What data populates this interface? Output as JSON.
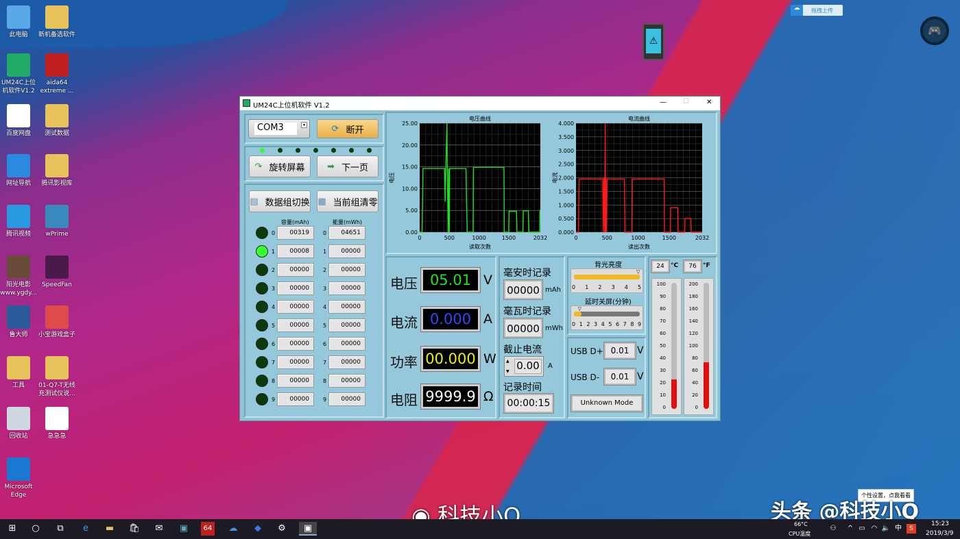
{
  "desktop": {
    "icons": [
      {
        "label": "此电脑",
        "color": "#5aa9e6"
      },
      {
        "label": "新机备选软件",
        "color": "#e8c25a"
      },
      {
        "label": "UM24C上位机软件V1.2",
        "color": "#2a6"
      },
      {
        "label": "aida64 extreme ...",
        "color": "#c02020"
      },
      {
        "label": "百度网盘",
        "color": "#fff"
      },
      {
        "label": "测试数据",
        "color": "#e8c25a"
      },
      {
        "label": "网址导航",
        "color": "#2a8ae0"
      },
      {
        "label": "腾讯影视库",
        "color": "#e8c25a"
      },
      {
        "label": "腾讯视频",
        "color": "#2a9ae0"
      },
      {
        "label": "wPrime",
        "color": "#3a8ac0"
      },
      {
        "label": "阳光电影 www.ygdy...",
        "color": "#6a4a3a"
      },
      {
        "label": "SpeedFan",
        "color": "#4a1a4a"
      },
      {
        "label": "鲁大师",
        "color": "#2a5a9a"
      },
      {
        "label": "小宝游戏盒子",
        "color": "#e04a4a"
      },
      {
        "label": "工具",
        "color": "#e8c25a"
      },
      {
        "label": "01-Q7-T无线充测试仪说...",
        "color": "#e8c25a"
      },
      {
        "label": "回收站",
        "color": "#cfd8e0"
      },
      {
        "label": "急急急",
        "color": "#fff"
      },
      {
        "label": "Microsoft Edge",
        "color": "#1a78d0"
      }
    ],
    "upload_label": "拖拽上传",
    "tooltip": "个性设置，点我看看",
    "watermark_left": "科技小Q",
    "watermark_right": "头条 @科技小Q"
  },
  "window": {
    "title": "UM24C上位机软件 V1.2",
    "minimize": "—",
    "maximize": "☐",
    "close": "✕"
  },
  "left": {
    "port": "COM3",
    "disconnect": "断开",
    "rotate": "旋转屏幕",
    "next_page": "下一页",
    "switch_group": "数据组切换",
    "clear_group": "当前组清零",
    "cap_header": "容量(mAh)",
    "energy_header": "能量(mWh)",
    "active_group": 1,
    "groups": [
      {
        "i": "0",
        "cap": "00319",
        "en": "04651"
      },
      {
        "i": "1",
        "cap": "00008",
        "en": "00000"
      },
      {
        "i": "2",
        "cap": "00000",
        "en": "00000"
      },
      {
        "i": "3",
        "cap": "00000",
        "en": "00000"
      },
      {
        "i": "4",
        "cap": "00000",
        "en": "00000"
      },
      {
        "i": "5",
        "cap": "00000",
        "en": "00000"
      },
      {
        "i": "6",
        "cap": "00000",
        "en": "00000"
      },
      {
        "i": "7",
        "cap": "00000",
        "en": "00000"
      },
      {
        "i": "8",
        "cap": "00000",
        "en": "00000"
      },
      {
        "i": "9",
        "cap": "00000",
        "en": "00000"
      }
    ]
  },
  "measure": {
    "voltage_label": "电压",
    "voltage": "05.01",
    "voltage_unit": "V",
    "current_label": "电流",
    "current": "0.000",
    "current_unit": "A",
    "power_label": "功率",
    "power": "00.000",
    "power_unit": "W",
    "resistance_label": "电阻",
    "resistance": "9999.9",
    "resistance_unit": "Ω"
  },
  "records": {
    "mah_label": "毫安时记录",
    "mah": "00000",
    "mah_unit": "mAh",
    "mwh_label": "毫瓦时记录",
    "mwh": "00000",
    "mwh_unit": "mWh",
    "cutoff_label": "截止电流",
    "cutoff": "0.00",
    "cutoff_unit": "A",
    "time_label": "记录时间",
    "time": "00:00:15"
  },
  "settings": {
    "backlight_label": "背光亮度",
    "backlight": 5,
    "backlight_ticks": [
      "0",
      "1",
      "2",
      "3",
      "4",
      "5"
    ],
    "timeout_label": "延时关屏(分钟)",
    "timeout": 1,
    "timeout_ticks": [
      "0",
      "1",
      "2",
      "3",
      "4",
      "5",
      "6",
      "7",
      "8",
      "9"
    ]
  },
  "usb": {
    "dp_label": "USB D+",
    "dp": "0.01",
    "dm_label": "USB D-",
    "dm": "0.01",
    "unit": "V",
    "mode": "Unknown Mode"
  },
  "temp": {
    "c": "24",
    "c_unit": "°C",
    "f": "76",
    "f_unit": "°F",
    "c_ticks": [
      "100",
      "90",
      "80",
      "70",
      "60",
      "50",
      "40",
      "30",
      "20",
      "10",
      "0"
    ],
    "f_ticks": [
      "200",
      "180",
      "160",
      "140",
      "120",
      "100",
      "80",
      "60",
      "40",
      "20",
      "0"
    ],
    "c_max": 100,
    "f_max": 200
  },
  "taskbar": {
    "cpu_temp": "66°C",
    "cpu_label": "CPU温度",
    "ime": "中",
    "time": "15:23",
    "date": "2019/3/9"
  },
  "chart_data": [
    {
      "type": "line",
      "title": "电压曲线",
      "xlabel": "读取次数",
      "ylabel": "电压",
      "xlim": [
        0,
        2032
      ],
      "ylim": [
        0,
        25
      ],
      "xticks": [
        "0",
        "500",
        "1000",
        "1500",
        "2032"
      ],
      "yticks": [
        "0.00",
        "5.00",
        "10.00",
        "15.00",
        "20.00",
        "25.00"
      ],
      "color": "#22e022",
      "grid": true,
      "x": [
        0,
        40,
        50,
        55,
        420,
        430,
        440,
        460,
        465,
        480,
        490,
        500,
        505,
        780,
        790,
        800,
        900,
        905,
        1420,
        1425,
        1500,
        1505,
        1630,
        1640,
        1740,
        1745,
        1830,
        1840,
        2020,
        2025,
        2032
      ],
      "y": [
        0,
        0,
        7,
        14.6,
        14.6,
        7,
        14.6,
        25,
        14.6,
        0,
        14.6,
        0,
        14.6,
        14.6,
        7,
        0,
        0,
        14.9,
        14.9,
        0,
        0,
        4.8,
        4.8,
        0,
        0,
        4.9,
        4.9,
        0,
        0,
        5,
        5
      ]
    },
    {
      "type": "line",
      "title": "电流曲线",
      "xlabel": "读出次数",
      "ylabel": "电流",
      "xlim": [
        0,
        2032
      ],
      "ylim": [
        0,
        4
      ],
      "xticks": [
        "0",
        "500",
        "1000",
        "1500",
        "2032"
      ],
      "yticks": [
        "0.000",
        "0.500",
        "1.000",
        "1.500",
        "2.000",
        "2.500",
        "3.000",
        "3.500",
        "4.000"
      ],
      "color": "#ff1a1a",
      "grid": true,
      "x": [
        0,
        40,
        50,
        430,
        440,
        450,
        460,
        470,
        475,
        480,
        490,
        500,
        780,
        790,
        900,
        905,
        1420,
        1425,
        1520,
        1525,
        1640,
        1645,
        1750,
        1755,
        1850,
        1855,
        2032
      ],
      "y": [
        0,
        0,
        1.95,
        1.95,
        0,
        2,
        0,
        4,
        0,
        2,
        0,
        1.95,
        1.95,
        0,
        0,
        1.95,
        1.95,
        0,
        0,
        0.9,
        0.9,
        0,
        0,
        0.5,
        0.5,
        0,
        0
      ]
    }
  ]
}
